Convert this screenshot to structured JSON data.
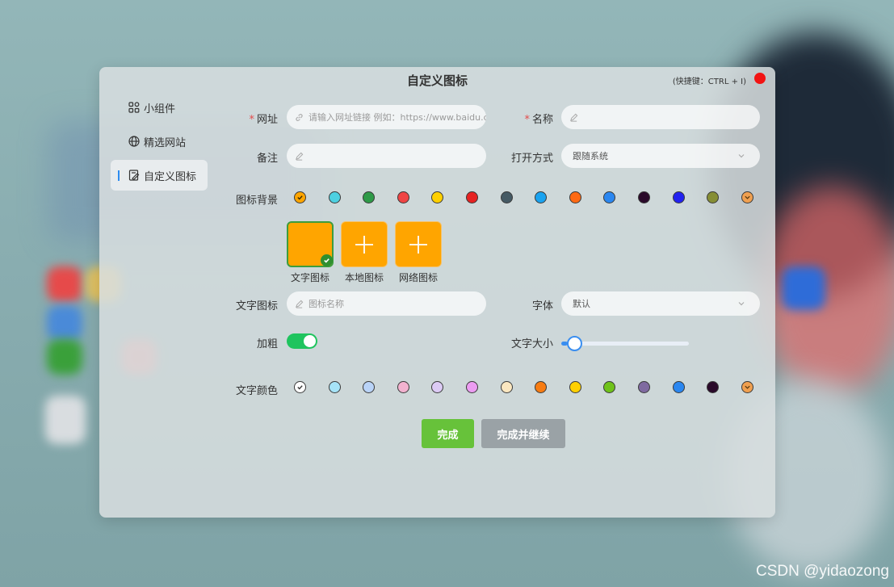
{
  "dialog": {
    "title": "自定义图标",
    "shortcut": "(快捷键：CTRL + I)"
  },
  "menu": {
    "items": [
      {
        "label": "小组件"
      },
      {
        "label": "精选网站"
      },
      {
        "label": "自定义图标"
      }
    ]
  },
  "form": {
    "url": {
      "label": "网址",
      "placeholder": "请输入网址链接 例如：https://www.baidu.c"
    },
    "name": {
      "label": "名称",
      "placeholder": ""
    },
    "remark": {
      "label": "备注",
      "placeholder": ""
    },
    "open_mode": {
      "label": "打开方式",
      "value": "跟随系统"
    },
    "icon_bg": {
      "label": "图标背景",
      "colors": [
        "#ffa500",
        "#4dd0e1",
        "#2e9a48",
        "#ef4444",
        "#ffd000",
        "#e62222",
        "#455a64",
        "#1aa3f0",
        "#ff6a13",
        "#2b87f0",
        "#2a0a2a",
        "#2222f0",
        "#868e35",
        "#f0a050"
      ]
    },
    "icon_types": [
      {
        "label": "文字图标"
      },
      {
        "label": "本地图标"
      },
      {
        "label": "网络图标"
      }
    ],
    "text_icon": {
      "label": "文字图标",
      "placeholder": "图标名称"
    },
    "font": {
      "label": "字体",
      "value": "默认"
    },
    "bold": {
      "label": "加粗",
      "on": true
    },
    "font_size": {
      "label": "文字大小",
      "level": 0.05
    },
    "text_color": {
      "label": "文字颜色",
      "colors": [
        "#ffffff",
        "#a6e3f7",
        "#b9d3f7",
        "#f2b2cf",
        "#dccbf5",
        "#ec9cf2",
        "#fbe7c0",
        "#f77c12",
        "#ffd000",
        "#6fc21a",
        "#7f6aa0",
        "#2b87f0",
        "#2a0a2a",
        "#f0a050"
      ]
    }
  },
  "buttons": {
    "done": "完成",
    "done_continue": "完成并继续"
  },
  "watermark": "CSDN @yidaozong"
}
